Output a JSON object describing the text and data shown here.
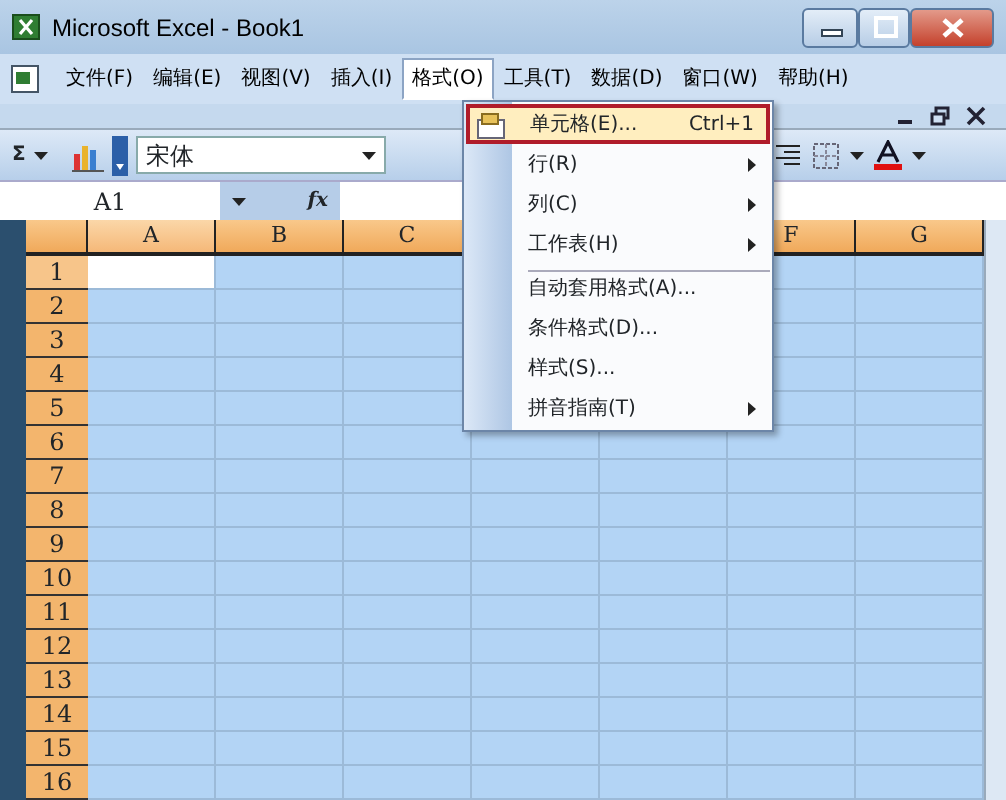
{
  "window": {
    "title": "Microsoft Excel - Book1"
  },
  "menubar": [
    {
      "label": "文件(F)",
      "selected": false
    },
    {
      "label": "编辑(E)",
      "selected": false
    },
    {
      "label": "视图(V)",
      "selected": false
    },
    {
      "label": "插入(I)",
      "selected": false
    },
    {
      "label": "格式(O)",
      "selected": true
    },
    {
      "label": "工具(T)",
      "selected": false
    },
    {
      "label": "数据(D)",
      "selected": false
    },
    {
      "label": "窗口(W)",
      "selected": false
    },
    {
      "label": "帮助(H)",
      "selected": false
    }
  ],
  "toolbar": {
    "autosum": "Σ",
    "font": "宋体"
  },
  "formula_bar": {
    "name_box": "A1",
    "fx": "fx"
  },
  "columns": [
    {
      "label": "A",
      "selected": true
    },
    {
      "label": "B",
      "selected": false
    },
    {
      "label": "C",
      "selected": false
    },
    {
      "label": "F",
      "selected": false,
      "after_hidden": true
    },
    {
      "label": "G",
      "selected": false
    }
  ],
  "rows": [
    {
      "label": "1",
      "selected": true
    },
    {
      "label": "2",
      "selected": false
    },
    {
      "label": "3",
      "selected": false
    },
    {
      "label": "4",
      "selected": false
    },
    {
      "label": "5",
      "selected": false
    },
    {
      "label": "6",
      "selected": false
    },
    {
      "label": "7",
      "selected": false
    },
    {
      "label": "8",
      "selected": false
    },
    {
      "label": "9",
      "selected": false
    },
    {
      "label": "10",
      "selected": false
    },
    {
      "label": "11",
      "selected": false
    },
    {
      "label": "12",
      "selected": false
    },
    {
      "label": "13",
      "selected": false
    },
    {
      "label": "14",
      "selected": false
    },
    {
      "label": "15",
      "selected": false
    },
    {
      "label": "16",
      "selected": false
    }
  ],
  "menu": [
    {
      "label": "单元格(E)...",
      "shortcut": "Ctrl+1",
      "icon": true,
      "submenu": false,
      "separator_before": false,
      "selected": true
    },
    {
      "label": "行(R)",
      "submenu": true,
      "separator_before": false,
      "selected": false
    },
    {
      "label": "列(C)",
      "submenu": true,
      "separator_before": false,
      "selected": false
    },
    {
      "label": "工作表(H)",
      "submenu": true,
      "separator_before": false,
      "selected": false
    },
    {
      "label": "自动套用格式(A)...",
      "submenu": false,
      "separator_before": true,
      "selected": false
    },
    {
      "label": "条件格式(D)...",
      "submenu": false,
      "separator_before": false,
      "selected": false
    },
    {
      "label": "样式(S)...",
      "submenu": false,
      "separator_before": false,
      "selected": false
    },
    {
      "label": "拼音指南(T)",
      "submenu": true,
      "separator_before": false,
      "selected": false
    }
  ]
}
